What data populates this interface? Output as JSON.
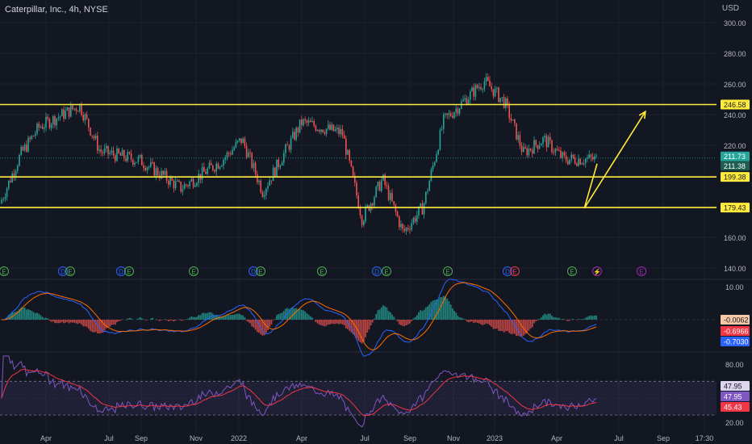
{
  "header": {
    "symbol_title": "Caterpillar, Inc., 4h, NYSE",
    "currency": "USD"
  },
  "colors": {
    "background": "#131722",
    "grid": "#1e222d",
    "up": "#26a69a",
    "down": "#ef5350",
    "level": "#ffeb3b",
    "macd_line": "#2962ff",
    "signal_line": "#ff6d00",
    "rsi_line": "#7e57c2",
    "rsi_ma": "#f23645"
  },
  "chart_data": [
    {
      "type": "candlestick",
      "pane": "price",
      "y_ticks": [
        "300.00",
        "280.00",
        "260.00",
        "240.00",
        "220.00",
        "200.00",
        "180.00",
        "160.00",
        "140.00"
      ],
      "y_range": [
        140,
        300
      ],
      "x_ticks": [
        "Apr",
        "Jul",
        "Sep",
        "Nov",
        "2022",
        "Apr",
        "Jul",
        "Sep",
        "Nov",
        "2023",
        "Apr",
        "Jul",
        "Sep",
        "17:30"
      ],
      "path_anchors": [
        {
          "date": "2021-01",
          "close": 182
        },
        {
          "date": "2021-02",
          "close": 214
        },
        {
          "date": "2021-03",
          "close": 232
        },
        {
          "date": "2021-05",
          "close": 246
        },
        {
          "date": "2021-06",
          "close": 216
        },
        {
          "date": "2021-08",
          "close": 210
        },
        {
          "date": "2021-10",
          "close": 192
        },
        {
          "date": "2021-12",
          "close": 210
        },
        {
          "date": "2022-01",
          "close": 224
        },
        {
          "date": "2022-02",
          "close": 190
        },
        {
          "date": "2022-04",
          "close": 235
        },
        {
          "date": "2022-06",
          "close": 228
        },
        {
          "date": "2022-07",
          "close": 172
        },
        {
          "date": "2022-08",
          "close": 198
        },
        {
          "date": "2022-09",
          "close": 163
        },
        {
          "date": "2022-10",
          "close": 180
        },
        {
          "date": "2022-11",
          "close": 236
        },
        {
          "date": "2023-01",
          "close": 262
        },
        {
          "date": "2023-02",
          "close": 248
        },
        {
          "date": "2023-03",
          "close": 215
        },
        {
          "date": "2023-04",
          "close": 224
        },
        {
          "date": "2023-05",
          "close": 211
        }
      ],
      "horizontal_levels": [
        "246.58",
        "199.38",
        "179.43"
      ],
      "price_labels": {
        "last": "211.73",
        "prev": "211.38"
      },
      "projection": [
        {
          "date": "2023-05",
          "price": 208
        },
        {
          "date": "2023-06",
          "price": 179
        },
        {
          "date": "2023-09",
          "price": 242
        }
      ],
      "event_markers": [
        "E",
        "E",
        "D",
        "E",
        "E",
        "E",
        "E",
        "D",
        "E",
        "E",
        "D",
        "E",
        "E",
        "⚡",
        "E"
      ]
    },
    {
      "type": "line",
      "pane": "macd",
      "y_ticks": [
        "10.00"
      ],
      "values_labels": [
        "-0.0062",
        "-0.6966",
        "-0.7030"
      ],
      "series": [
        {
          "name": "",
          "values": []
        }
      ]
    },
    {
      "type": "line",
      "pane": "rsi",
      "y_ticks": [
        "80.00",
        "20.00"
      ],
      "bands": [
        70,
        30
      ],
      "values_labels": [
        "47.95",
        "47.95",
        "45.43"
      ]
    }
  ]
}
